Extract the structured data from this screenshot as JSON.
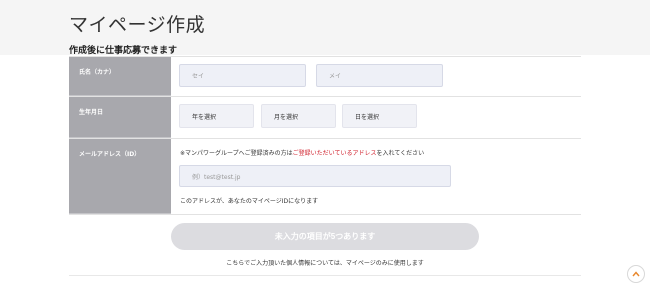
{
  "header": {
    "title": "マイページ作成",
    "subtitle": "作成後に仕事応募できます"
  },
  "form": {
    "name": {
      "label": "氏名（カナ）",
      "sei_placeholder": "セイ",
      "mei_placeholder": "メイ"
    },
    "birth": {
      "label": "生年月日",
      "year": "年を選択",
      "month": "月を選択",
      "day": "日を選択"
    },
    "email": {
      "label": "メールアドレス（ID）",
      "note_prefix": "※マンパワーグループへご登録済みの方は",
      "note_highlight": "ご登録いただいているアドレス",
      "note_suffix": "を入れてください",
      "placeholder": "例）test@test.jp",
      "hint": "このアドレスが、あなたのマイページIDになります"
    }
  },
  "submit_label": "未入力の項目が5つあります",
  "privacy_note": "こちらでご入力頂いた個人情報については、マイページのみに使用します",
  "colors": {
    "label_bg": "#a8a8ad",
    "input_bg": "#eef0f7",
    "highlight": "#d0202c",
    "button_disabled": "#dcdce0"
  },
  "icons": {
    "scroll_top": "chevron-up-icon"
  }
}
